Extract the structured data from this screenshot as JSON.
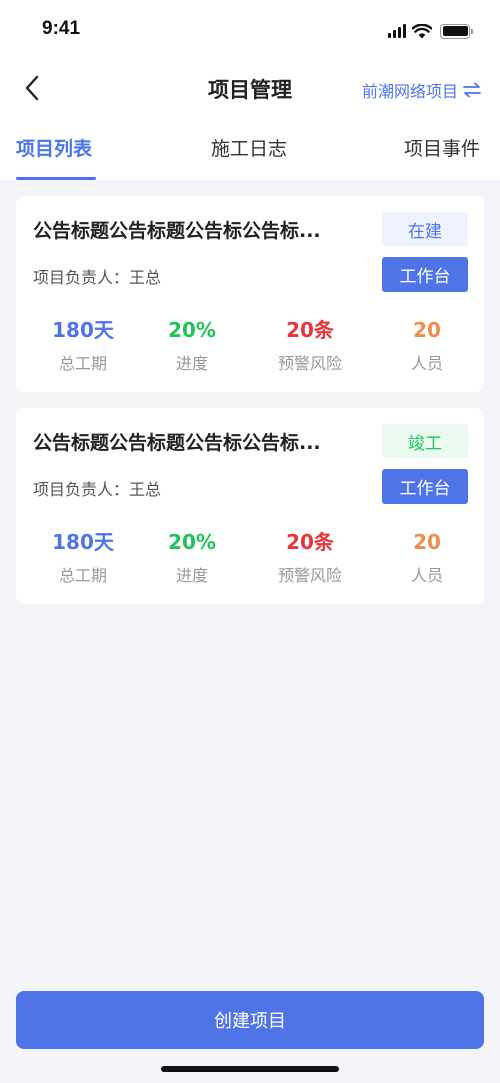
{
  "status_bar": {
    "time": "9:41"
  },
  "nav": {
    "title": "项目管理",
    "project_switch_label": "前潮网络项目"
  },
  "tabs": [
    {
      "label": "项目列表",
      "active": true
    },
    {
      "label": "施工日志",
      "active": false
    },
    {
      "label": "项目事件",
      "active": false
    }
  ],
  "projects": [
    {
      "title": "公告标题公告标题公告标公告标...",
      "status": "在建",
      "owner": "项目负责人：王总",
      "workbench_label": "工作台",
      "stats": {
        "duration": {
          "value": "180天",
          "label": "总工期"
        },
        "progress": {
          "value": "20%",
          "label": "进度"
        },
        "warnings": {
          "value": "20条",
          "label": "预警风险"
        },
        "people": {
          "value": "20",
          "label": "人员"
        }
      }
    },
    {
      "title": "公告标题公告标题公告标公告标...",
      "status": "竣工",
      "owner": "项目负责人：王总",
      "workbench_label": "工作台",
      "stats": {
        "duration": {
          "value": "180天",
          "label": "总工期"
        },
        "progress": {
          "value": "20%",
          "label": "进度"
        },
        "warnings": {
          "value": "20条",
          "label": "预警风险"
        },
        "people": {
          "value": "20",
          "label": "人员"
        }
      }
    }
  ],
  "create_button_label": "创建项目",
  "colors": {
    "accent": "#4e74e8",
    "green": "#21c45a",
    "red": "#e8353a",
    "orange": "#ef8c4e"
  }
}
